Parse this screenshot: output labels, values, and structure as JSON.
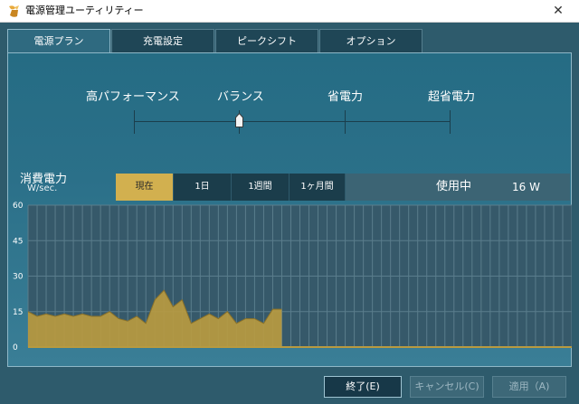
{
  "window": {
    "title": "電源管理ユーティリティー",
    "close_glyph": "✕"
  },
  "tabs": [
    {
      "label": "電源プラン",
      "active": true
    },
    {
      "label": "充電設定",
      "active": false
    },
    {
      "label": "ピークシフト",
      "active": false
    },
    {
      "label": "オプション",
      "active": false
    }
  ],
  "plan_slider": {
    "labels": [
      "高パフォーマンス",
      "バランス",
      "省電力",
      "超省電力"
    ],
    "selected_index": 1
  },
  "usage": {
    "title": "消費電力",
    "unit": "W/sec.",
    "periods": [
      "現在",
      "1日",
      "1週間",
      "1ヶ月間"
    ],
    "selected_period": 0,
    "status_label": "使用中",
    "status_value": "16 W"
  },
  "chart_data": {
    "type": "area",
    "y_ticks": [
      "60",
      "45",
      "30",
      "15",
      "0"
    ],
    "ylim": [
      0,
      60
    ],
    "values": [
      15,
      13,
      14,
      13,
      14,
      13,
      14,
      13,
      13,
      15,
      12,
      11,
      13,
      10,
      20,
      24,
      17,
      20,
      10,
      12,
      14,
      12,
      15,
      10,
      12,
      12,
      10,
      16,
      16
    ],
    "total_slots": 60,
    "grid": true,
    "fill_color": "#b89a40",
    "background_color": "#36596a"
  },
  "buttons": {
    "exit": "終了(E)",
    "cancel": "キャンセル(C)",
    "apply": "適用（A)"
  }
}
